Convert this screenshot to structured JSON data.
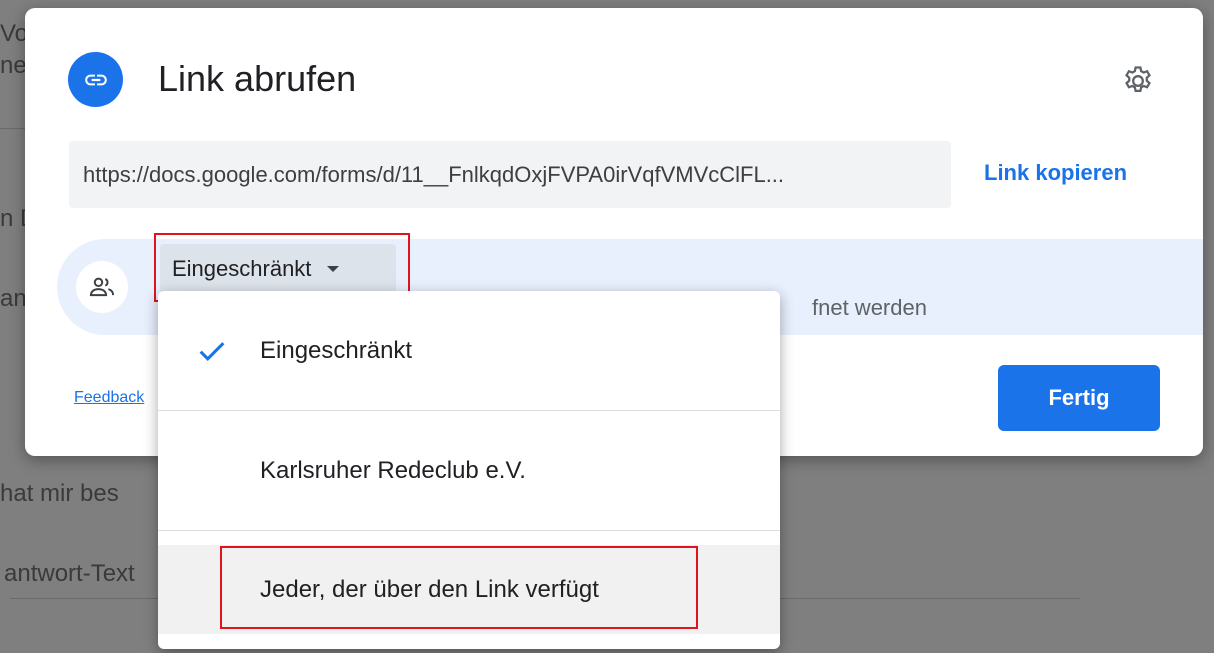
{
  "background": {
    "fragments": [
      "Vo",
      "ne",
      "n D",
      "an",
      "hat mir bes",
      "antwort-Text"
    ]
  },
  "dialog": {
    "title": "Link abrufen",
    "url": "https://docs.google.com/forms/d/11__FnlkqdOxjFVPA0irVqfVMVcClFL...",
    "copy_label": "Link kopieren",
    "access_value": "Eingeschränkt",
    "access_description_visible": "fnet werden",
    "feedback_label": "Feedback",
    "done_label": "Fertig",
    "icons": {
      "link": "link-icon",
      "settings": "gear-icon",
      "people": "people-icon",
      "dropdown": "caret-down-icon"
    },
    "colors": {
      "accent": "#1a73e8",
      "highlight": "#e0141e",
      "access_band": "#e8f0fe"
    }
  },
  "dropdown": {
    "options": [
      {
        "label": "Eingeschränkt",
        "selected": true
      },
      {
        "label": "Karlsruher Redeclub e.V.",
        "selected": false
      },
      {
        "label": "Jeder, der über den Link verfügt",
        "selected": false
      }
    ]
  }
}
